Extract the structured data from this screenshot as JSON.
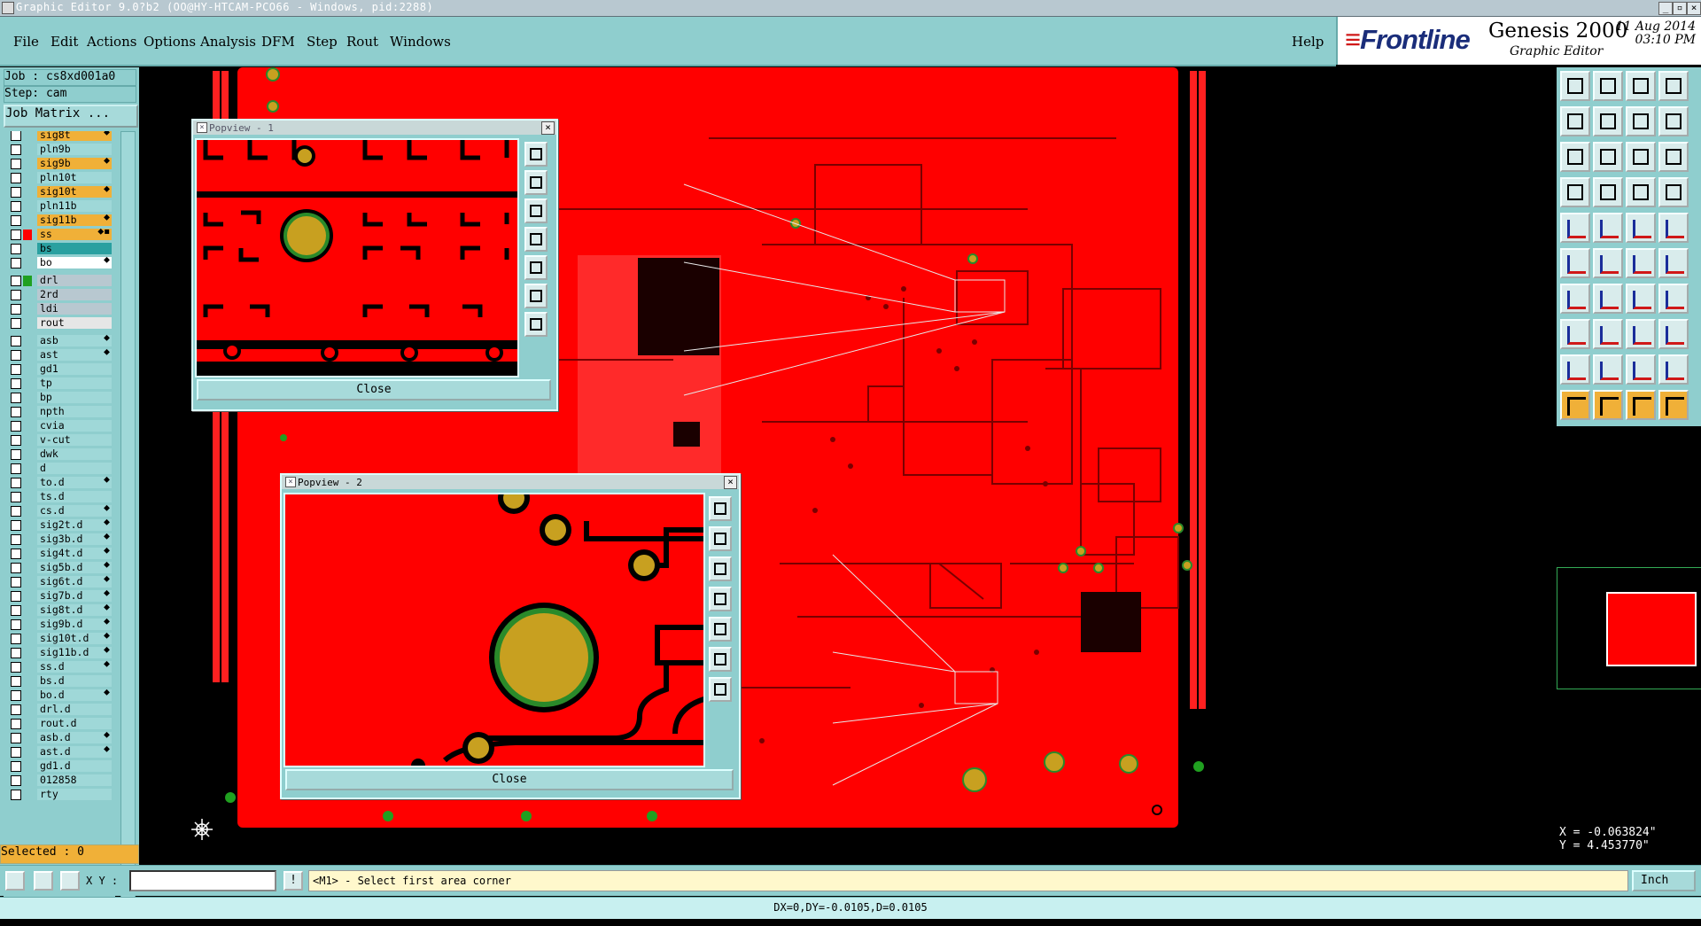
{
  "window": {
    "title": "Graphic Editor 9.0?b2 (OO@HY-HTCAM-PCO66 - Windows, pid:2288)"
  },
  "menu": {
    "file": "File",
    "edit": "Edit",
    "actions": "Actions",
    "options": "Options",
    "analysis": "Analysis",
    "dfm": "DFM",
    "step": "Step",
    "rout": "Rout",
    "windows": "Windows",
    "help": "Help"
  },
  "brand": {
    "logo": "Frontline",
    "product": "Genesis 2000",
    "subtitle": "Graphic Editor",
    "date": "11 Aug 2014",
    "time": "03:10 PM"
  },
  "job": {
    "job_line": "Job : cs8xd001a0",
    "step_line": "Step: cam",
    "matrix_button": "Job Matrix ..."
  },
  "layers": [
    {
      "name": "sig8t",
      "bg": "#f0b038",
      "color": "",
      "mark": "⬥"
    },
    {
      "name": "pln9b",
      "bg": "#9fd8d8",
      "color": "",
      "mark": ""
    },
    {
      "name": "sig9b",
      "bg": "#f0b038",
      "color": "",
      "mark": "⬥"
    },
    {
      "name": "pln10t",
      "bg": "#9fd8d8",
      "color": "",
      "mark": ""
    },
    {
      "name": "sig10t",
      "bg": "#f0b038",
      "color": "",
      "mark": "⬥"
    },
    {
      "name": "pln11b",
      "bg": "#9fd8d8",
      "color": "",
      "mark": ""
    },
    {
      "name": "sig11b",
      "bg": "#f0b038",
      "color": "",
      "mark": "⬥"
    },
    {
      "name": "ss",
      "bg": "#f0b038",
      "color": "#ff0000",
      "mark": "⬥▪"
    },
    {
      "name": "bs",
      "bg": "#2aa0a0",
      "color": "",
      "mark": ""
    },
    {
      "name": "bo",
      "bg": "#ffffff",
      "color": "",
      "mark": "⬥"
    },
    {
      "name": "drl",
      "bg": "#b8c8d0",
      "color": "#20a020",
      "mark": ""
    },
    {
      "name": "2rd",
      "bg": "#b8c8d0",
      "color": "",
      "mark": ""
    },
    {
      "name": "ldi",
      "bg": "#b8c8d0",
      "color": "",
      "mark": ""
    },
    {
      "name": "rout",
      "bg": "#e6e6e6",
      "color": "",
      "mark": ""
    },
    {
      "name": "asb",
      "bg": "#9fd8d8",
      "color": "",
      "mark": "⬥"
    },
    {
      "name": "ast",
      "bg": "#9fd8d8",
      "color": "",
      "mark": "⬥"
    },
    {
      "name": "gd1",
      "bg": "#9fd8d8",
      "color": "",
      "mark": ""
    },
    {
      "name": "tp",
      "bg": "#9fd8d8",
      "color": "",
      "mark": ""
    },
    {
      "name": "bp",
      "bg": "#9fd8d8",
      "color": "",
      "mark": ""
    },
    {
      "name": "npth",
      "bg": "#9fd8d8",
      "color": "",
      "mark": ""
    },
    {
      "name": "cvia",
      "bg": "#9fd8d8",
      "color": "",
      "mark": ""
    },
    {
      "name": "v-cut",
      "bg": "#9fd8d8",
      "color": "",
      "mark": ""
    },
    {
      "name": "dwk",
      "bg": "#9fd8d8",
      "color": "",
      "mark": ""
    },
    {
      "name": "d",
      "bg": "#9fd8d8",
      "color": "",
      "mark": ""
    },
    {
      "name": "to.d",
      "bg": "#9fd8d8",
      "color": "",
      "mark": "⬥"
    },
    {
      "name": "ts.d",
      "bg": "#9fd8d8",
      "color": "",
      "mark": ""
    },
    {
      "name": "cs.d",
      "bg": "#9fd8d8",
      "color": "",
      "mark": "⬥"
    },
    {
      "name": "sig2t.d",
      "bg": "#9fd8d8",
      "color": "",
      "mark": "⬥"
    },
    {
      "name": "sig3b.d",
      "bg": "#9fd8d8",
      "color": "",
      "mark": "⬥"
    },
    {
      "name": "sig4t.d",
      "bg": "#9fd8d8",
      "color": "",
      "mark": "⬥"
    },
    {
      "name": "sig5b.d",
      "bg": "#9fd8d8",
      "color": "",
      "mark": "⬥"
    },
    {
      "name": "sig6t.d",
      "bg": "#9fd8d8",
      "color": "",
      "mark": "⬥"
    },
    {
      "name": "sig7b.d",
      "bg": "#9fd8d8",
      "color": "",
      "mark": "⬥"
    },
    {
      "name": "sig8t.d",
      "bg": "#9fd8d8",
      "color": "",
      "mark": "⬥"
    },
    {
      "name": "sig9b.d",
      "bg": "#9fd8d8",
      "color": "",
      "mark": "⬥"
    },
    {
      "name": "sig10t.d",
      "bg": "#9fd8d8",
      "color": "",
      "mark": "⬥"
    },
    {
      "name": "sig11b.d",
      "bg": "#9fd8d8",
      "color": "",
      "mark": "⬥"
    },
    {
      "name": "ss.d",
      "bg": "#9fd8d8",
      "color": "",
      "mark": "⬥"
    },
    {
      "name": "bs.d",
      "bg": "#9fd8d8",
      "color": "",
      "mark": ""
    },
    {
      "name": "bo.d",
      "bg": "#9fd8d8",
      "color": "",
      "mark": "⬥"
    },
    {
      "name": "drl.d",
      "bg": "#9fd8d8",
      "color": "",
      "mark": ""
    },
    {
      "name": "rout.d",
      "bg": "#9fd8d8",
      "color": "",
      "mark": ""
    },
    {
      "name": "asb.d",
      "bg": "#9fd8d8",
      "color": "",
      "mark": "⬥"
    },
    {
      "name": "ast.d",
      "bg": "#9fd8d8",
      "color": "",
      "mark": "⬥"
    },
    {
      "name": "gd1.d",
      "bg": "#9fd8d8",
      "color": "",
      "mark": ""
    },
    {
      "name": "012858",
      "bg": "#9fd8d8",
      "color": "",
      "mark": ""
    },
    {
      "name": "rty",
      "bg": "#9fd8d8",
      "color": "",
      "mark": ""
    }
  ],
  "selected": "Selected : 0",
  "popview1": {
    "title": "Popview - 1",
    "close_label": "Close"
  },
  "popview2": {
    "title": "Popview - 2",
    "close_label": "Close"
  },
  "bottom": {
    "xy_label": "X Y :",
    "xy_value": "",
    "message": "<M1> - Select first area corner",
    "unit": "Inch"
  },
  "coords": {
    "x": "X = -0.063824\"",
    "y": "Y = 4.453770\""
  },
  "status": "DX=0,DY=-0.0105,D=0.0105",
  "colors": {
    "board": "#ff0000",
    "pad": "#c8a020",
    "pad_ring": "#2a8a2a",
    "panel": "#8fcece",
    "layer_active": "#f0b038"
  }
}
